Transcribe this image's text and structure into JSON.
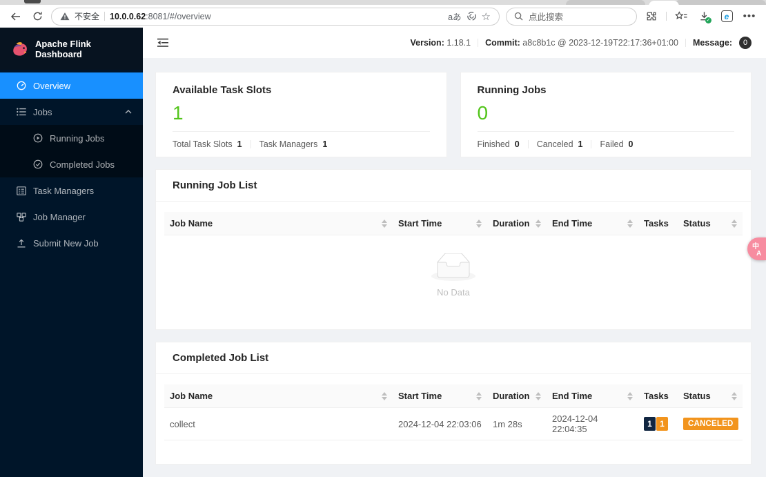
{
  "browser": {
    "security_label": "不安全",
    "url_host": "10.0.0.62",
    "url_rest": ":8081/#/overview",
    "translate_icon_text": "aあ",
    "search_placeholder": "点此搜索"
  },
  "app_header": {
    "version_label": "Version:",
    "version_value": "1.18.1",
    "commit_label": "Commit:",
    "commit_value": "a8c8b1c @ 2023-12-19T22:17:36+01:00",
    "message_label": "Message:",
    "message_count": "0"
  },
  "sidebar": {
    "title": "Apache Flink Dashboard",
    "overview": "Overview",
    "jobs": "Jobs",
    "running_jobs": "Running Jobs",
    "completed_jobs": "Completed Jobs",
    "task_managers": "Task Managers",
    "job_manager": "Job Manager",
    "submit_new_job": "Submit New Job"
  },
  "slots_card": {
    "title": "Available Task Slots",
    "value": "1",
    "stats": [
      {
        "label": "Total Task Slots",
        "value": "1"
      },
      {
        "label": "Task Managers",
        "value": "1"
      }
    ]
  },
  "jobs_card": {
    "title": "Running Jobs",
    "value": "0",
    "stats": [
      {
        "label": "Finished",
        "value": "0"
      },
      {
        "label": "Canceled",
        "value": "1"
      },
      {
        "label": "Failed",
        "value": "0"
      }
    ]
  },
  "running_table": {
    "title": "Running Job List",
    "columns": [
      "Job Name",
      "Start Time",
      "Duration",
      "End Time",
      "Tasks",
      "Status"
    ],
    "empty_text": "No Data"
  },
  "completed_table": {
    "title": "Completed Job List",
    "columns": [
      "Job Name",
      "Start Time",
      "Duration",
      "End Time",
      "Tasks",
      "Status"
    ],
    "row": {
      "job_name": "collect",
      "start_time": "2024-12-04 22:03:06",
      "duration": "1m 28s",
      "end_time": "2024-12-04 22:04:35",
      "tasks_total": "1",
      "tasks_canceled": "1",
      "status": "CANCELED"
    }
  },
  "translate_button": {
    "text_top": "中",
    "text_bottom": "A"
  },
  "colors": {
    "accent_blue": "#1890ff",
    "success_green": "#52c41a",
    "warning_orange": "#f2941d",
    "badge_navy": "#112641",
    "sidebar_bg": "#001529",
    "submenu_bg": "#000c17",
    "content_bg": "#f0f2f5",
    "translate_pink": "#f78ca0"
  }
}
